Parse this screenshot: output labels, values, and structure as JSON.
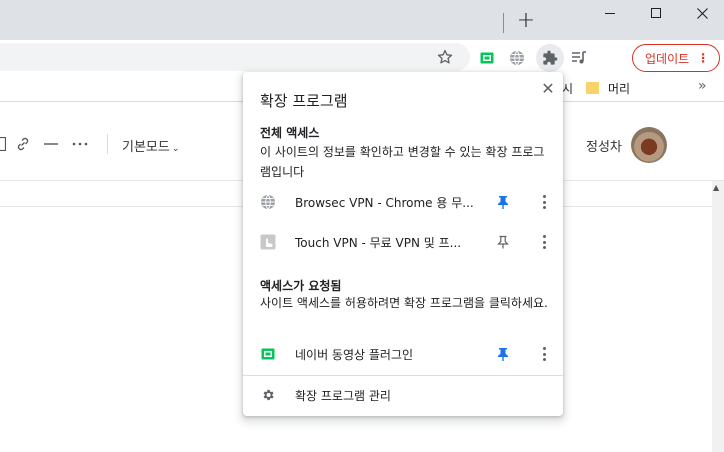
{
  "window": {
    "newtab_symbol": "+"
  },
  "toolbar": {
    "update_label": "업데이트",
    "update_more": "⋮",
    "icons": [
      "star-icon",
      "naver-video-icon",
      "globe-icon",
      "puzzle-icon",
      "media-control-icon"
    ]
  },
  "bookmarks": {
    "partial_label": "시",
    "folder_label": "머리",
    "more": "»"
  },
  "page": {
    "mode_label": "기본모드",
    "user_name": "정성차"
  },
  "extensions_popup": {
    "title": "확장 프로그램",
    "close": "✕",
    "full_access": {
      "heading": "전체 액세스",
      "description": "이 사이트의 정보를 확인하고 변경할 수 있는 확장 프로그램입니다",
      "items": [
        {
          "label": "Browsec VPN - Chrome 용 무...",
          "icon": "globe-icon",
          "pinned": true
        },
        {
          "label": "Touch VPN - 무료 VPN 및 프...",
          "icon": "touch-vpn-icon",
          "pinned": false
        }
      ]
    },
    "access_requested": {
      "heading": "액세스가 요청됨",
      "description": "사이트 액세스를 허용하려면 확장 프로그램을 클릭하세요.",
      "items": [
        {
          "label": "네이버 동영상 플러그인",
          "icon": "naver-video-icon",
          "pinned": true
        }
      ]
    },
    "manage_label": "확장 프로그램 관리"
  },
  "colors": {
    "accent_blue": "#1a73e8",
    "update_red": "#d93025",
    "naver_green": "#03c75a"
  }
}
